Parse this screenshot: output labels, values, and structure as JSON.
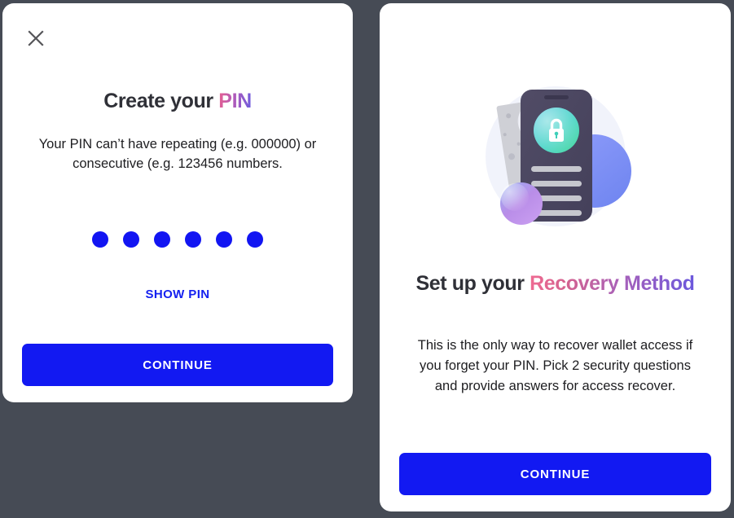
{
  "theme": {
    "background": "#464b55",
    "card_background": "#ffffff",
    "accent_blue": "#1219f2",
    "heading_dark": "#2f3037",
    "link_blue": "#1521f0",
    "gradient_pink": "#ef6a92",
    "gradient_purple": "#a861b9",
    "gradient_violet": "#6a58dd",
    "lock_teal": "#3fd0c9",
    "lock_green": "#4ed8a8",
    "phone_dark": "#4b4760",
    "sphere_purple": "#b388e8",
    "circle_blue": "#7b8cf5"
  },
  "pin_screen": {
    "close_icon": "close-icon",
    "heading": {
      "plain": "Create your",
      "accent": "PIN"
    },
    "description": "Your PIN can’t have repeating (e.g. 000000) or consecutive (e.g. 123456 numbers.",
    "pin_entry": {
      "length": 6,
      "filled": 6,
      "dots": [
        "●",
        "●",
        "●",
        "●",
        "●",
        "●"
      ]
    },
    "show_pin_label": "SHOW PIN",
    "continue_label": "CONTINUE"
  },
  "recovery_screen": {
    "back_icon": "arrow-left-icon",
    "illustration": {
      "name": "phone-lock-illustration",
      "elements": [
        "background-circle",
        "document-card",
        "phone-frame",
        "lock-badge-icon",
        "text-line",
        "text-line",
        "text-line",
        "text-line",
        "blue-circle",
        "purple-sphere"
      ]
    },
    "heading": {
      "plain": "Set up your",
      "accent": "Recovery Method"
    },
    "description": "This is the only way to recover wallet access if you forget your PIN. Pick 2 security questions and provide answers for access recover.",
    "continue_label": "CONTINUE"
  }
}
